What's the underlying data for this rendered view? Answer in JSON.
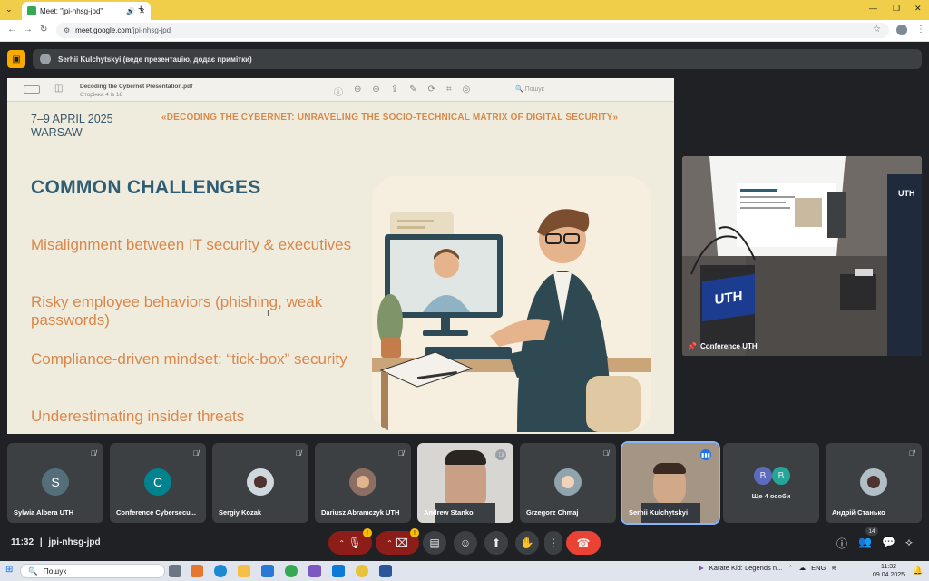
{
  "browser": {
    "tab_title": "Meet: \"jpi-nhsg-jpd\"",
    "url_host": "meet.google.com",
    "url_path": "/jpi-nhsg-jpd"
  },
  "presenter_bar": {
    "text": "Serhii Kulchytskyi (веде презентацію, додає примітки)"
  },
  "pdf_viewer": {
    "file_name": "Decoding the Cybernet Presentation.pdf",
    "page_info": "Сторінка 4 із 18",
    "search_placeholder": "Пошук"
  },
  "slide": {
    "dates_line1": "7–9 APRIL 2025",
    "dates_line2": "WARSAW",
    "conference_title": "«DECODING THE CYBERNET: UNRAVELING THE SOCIO-TECHNICAL MATRIX OF DIGITAL SECURITY»",
    "heading": "COMMON CHALLENGES",
    "challenges": [
      "Misalignment between IT security & executives",
      "Risky employee behaviors (phishing, weak passwords)",
      "Compliance-driven mindset: “tick-box” security",
      "Underestimating insider threats"
    ]
  },
  "camera_tile": {
    "name": "Conference UTH",
    "screen_logo": "UTH"
  },
  "participants": [
    {
      "name": "Sylwia Albera UTH",
      "initial": "S",
      "color": "#546e7a"
    },
    {
      "name": "Conference Cybersecu...",
      "initial": "C",
      "color": "#00838f"
    },
    {
      "name": "Sergiy Kozak",
      "initial": "",
      "color": "#cfd8dc"
    },
    {
      "name": "Dariusz Abramczyk UTH",
      "initial": "",
      "color": "#8d6e63"
    },
    {
      "name": "Andrew Stanko",
      "initial": "",
      "color": "#6d6a67"
    },
    {
      "name": "Grzegorz Chmaj",
      "initial": "",
      "color": "#90a4ae"
    },
    {
      "name": "Serhii Kulchytskyi",
      "initial": "",
      "color": "#7b6d62"
    },
    {
      "name": "Ще 4 особи",
      "initial": "B",
      "color": "#5c6bc0"
    },
    {
      "name": "Андрій Станько",
      "initial": "",
      "color": "#b0bec5"
    }
  ],
  "more_initial_2": "B",
  "controls": {
    "time": "11:32",
    "separator": "|",
    "meeting_code": "jpi-nhsg-jpd",
    "people_count": "14",
    "warning_badge": "!"
  },
  "taskbar": {
    "search_label": "Пошук",
    "media_title": "Karate Kid: Legends n...",
    "lang": "ENG",
    "time": "11:32",
    "date": "09.04.2025"
  }
}
